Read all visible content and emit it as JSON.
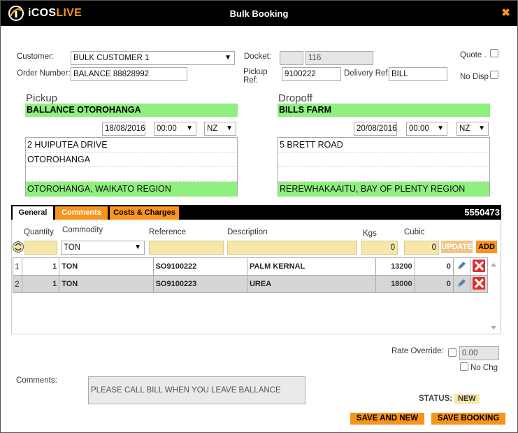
{
  "window": {
    "title": "Bulk Booking",
    "close_icon": "✖",
    "logo_prefix": "iCOS",
    "logo_suffix": "LIVE"
  },
  "header": {
    "customer_label": "Customer:",
    "customer_value": "BULK CUSTOMER 1",
    "order_label": "Order Number:",
    "order_value": "BALANCE 88828992",
    "docket_label": "Docket:",
    "docket_prefix": "",
    "docket_value": "116",
    "pickup_ref_label_1": "Pickup",
    "pickup_ref_label_2": "Ref:",
    "pickup_ref_value": "9100222",
    "delivery_ref_label": "Delivery Ref:",
    "delivery_ref_value": "BILL",
    "quote_label": "Quote .",
    "nodisp_label": "No Disp"
  },
  "pickup": {
    "heading": "Pickup",
    "name": "BALLANCE OTOROHANGA",
    "date": "18/08/2016",
    "time": "00:00",
    "tz": "NZ",
    "address": [
      "2 HUIPUTEA DRIVE",
      "OTOROHANGA",
      ""
    ],
    "region": "OTOROHANGA, WAIKATO REGION"
  },
  "dropoff": {
    "heading": "Dropoff",
    "name": "BILLS FARM",
    "date": "20/08/2016",
    "time": "00:00",
    "tz": "NZ",
    "address": [
      "5 BRETT ROAD",
      "",
      ""
    ],
    "region": "REREWHAKAAITU, BAY OF PLENTY REGION"
  },
  "tabs": {
    "general": "General",
    "comments": "Comments",
    "costs": "Costs & Charges",
    "booking_number": "5550473"
  },
  "entry": {
    "col_quantity": "Quantity",
    "col_commodity": "Commodity",
    "col_reference": "Reference",
    "col_description": "Description",
    "col_kgs": "Kgs",
    "col_cubic": "Cubic",
    "commodity_value": "TON",
    "kgs_value": "0",
    "cubic_value": "0",
    "update_label": "UPDATE",
    "add_label": "ADD"
  },
  "rows": [
    {
      "idx": "1",
      "qty": "1",
      "commodity": "TON",
      "reference": "SO9100222",
      "description": "PALM KERNAL",
      "kgs": "13200",
      "cubic": "0"
    },
    {
      "idx": "2",
      "qty": "1",
      "commodity": "TON",
      "reference": "SO9100223",
      "description": "UREA",
      "kgs": "18000",
      "cubic": "0"
    }
  ],
  "footer": {
    "rate_override_label": "Rate Override:",
    "rate_override_value": "0.00",
    "no_chg_label": "No Chg",
    "comments_label": "Comments:",
    "comments_value": "PLEASE CALL BILL WHEN YOU LEAVE BALLANCE",
    "status_label": "STATUS:",
    "status_value": "NEW",
    "save_and_new": "SAVE AND NEW",
    "save_booking": "SAVE BOOKING"
  },
  "colors": {
    "accent_orange": "#f7941d",
    "highlight_green": "#8fef7f",
    "field_yellow": "#f6e7a9",
    "titlebar": "#000000"
  }
}
